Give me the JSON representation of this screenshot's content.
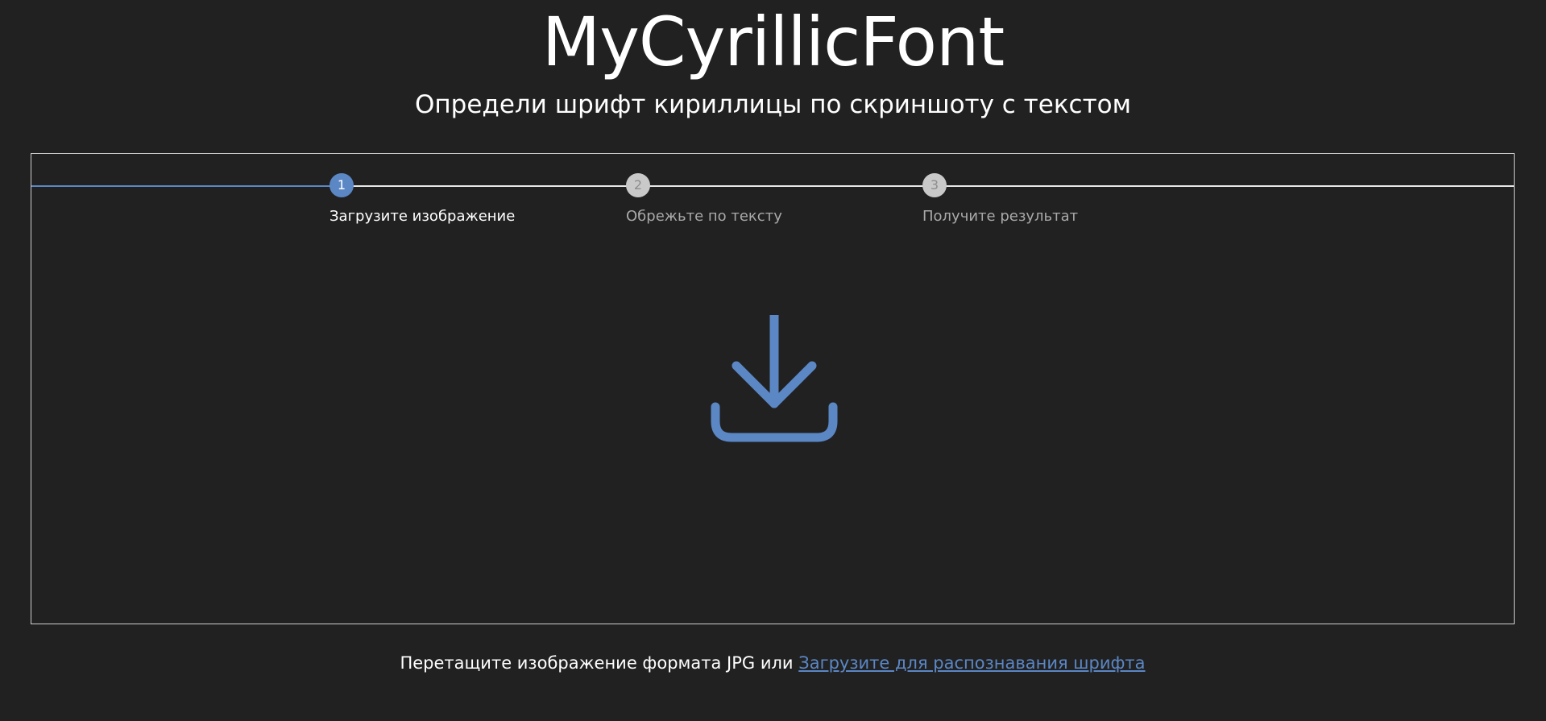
{
  "header": {
    "title": "MyCyrillicFont",
    "subtitle": "Определи шрифт кириллицы по скриншоту с текстом"
  },
  "stepper": {
    "active_step": 1,
    "steps": [
      {
        "number": "1",
        "label": "Загрузите изображение"
      },
      {
        "number": "2",
        "label": "Обрежьте по тексту"
      },
      {
        "number": "3",
        "label": "Получите результат"
      }
    ]
  },
  "upload": {
    "icon": "download-icon",
    "text": "Перетащите изображение формата JPG или ",
    "link_label": "Загрузите для распознавания шрифта"
  },
  "colors": {
    "background": "#212121",
    "accent": "#5b87c5",
    "inactive": "#c9c9c9",
    "border": "#cfcfcf"
  }
}
